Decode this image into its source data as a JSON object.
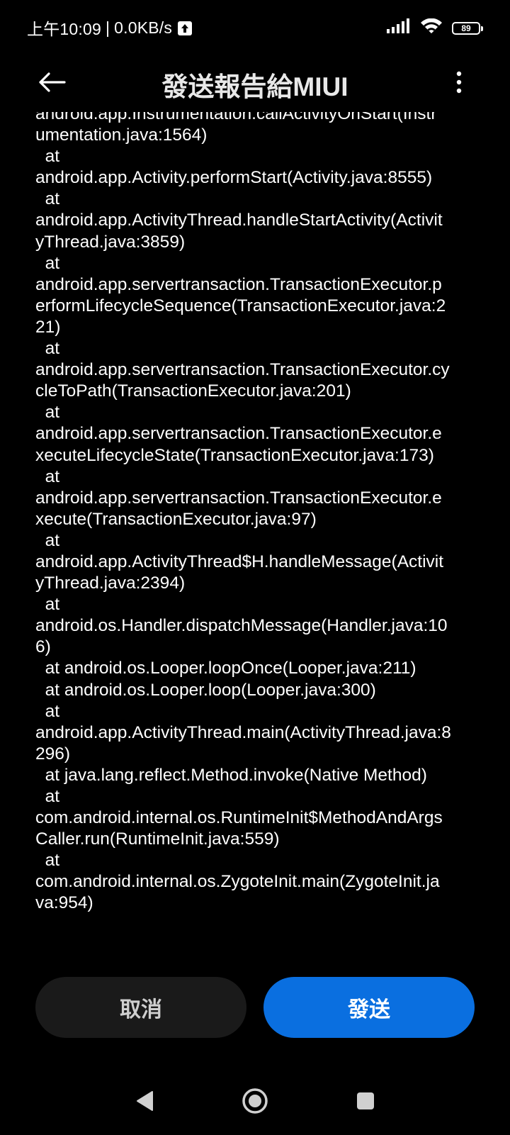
{
  "status_bar": {
    "time": "上午10:09",
    "separator": "|",
    "net_speed": "0.0KB/s",
    "upload_icon": "upload-arrow-icon",
    "signal_icon": "cellular-signal-icon",
    "wifi_icon": "wifi-icon",
    "battery_level": "89"
  },
  "header": {
    "back_icon": "arrow-left-icon",
    "title": "發送報告給MIUI",
    "more_icon": "more-vertical-icon"
  },
  "report": {
    "lines": [
      "android.app.Instrumentation.callActivityOnStart(Instr",
      "umentation.java:1564)",
      "  at",
      "android.app.Activity.performStart(Activity.java:8555)",
      "  at",
      "android.app.ActivityThread.handleStartActivity(Activit",
      "yThread.java:3859)",
      "  at",
      "android.app.servertransaction.TransactionExecutor.p",
      "erformLifecycleSequence(TransactionExecutor.java:2",
      "21)",
      "  at",
      "android.app.servertransaction.TransactionExecutor.cy",
      "cleToPath(TransactionExecutor.java:201)",
      "  at",
      "android.app.servertransaction.TransactionExecutor.e",
      "xecuteLifecycleState(TransactionExecutor.java:173)",
      "  at",
      "android.app.servertransaction.TransactionExecutor.e",
      "xecute(TransactionExecutor.java:97)",
      "  at",
      "android.app.ActivityThread$H.handleMessage(Activit",
      "yThread.java:2394)",
      "  at",
      "android.os.Handler.dispatchMessage(Handler.java:10",
      "6)",
      "  at android.os.Looper.loopOnce(Looper.java:211)",
      "  at android.os.Looper.loop(Looper.java:300)",
      "  at",
      "android.app.ActivityThread.main(ActivityThread.java:8",
      "296)",
      "  at java.lang.reflect.Method.invoke(Native Method)",
      "  at",
      "com.android.internal.os.RuntimeInit$MethodAndArgs",
      "Caller.run(RuntimeInit.java:559)",
      "  at",
      "com.android.internal.os.ZygoteInit.main(ZygoteInit.ja",
      "va:954)"
    ]
  },
  "actions": {
    "cancel_label": "取消",
    "send_label": "發送"
  },
  "nav": {
    "back_icon": "nav-back-triangle-icon",
    "home_icon": "nav-home-circle-icon",
    "recent_icon": "nav-recents-square-icon"
  },
  "colors": {
    "background": "#000000",
    "send_button": "#0a6fe0",
    "cancel_button": "#1a1a1a"
  }
}
